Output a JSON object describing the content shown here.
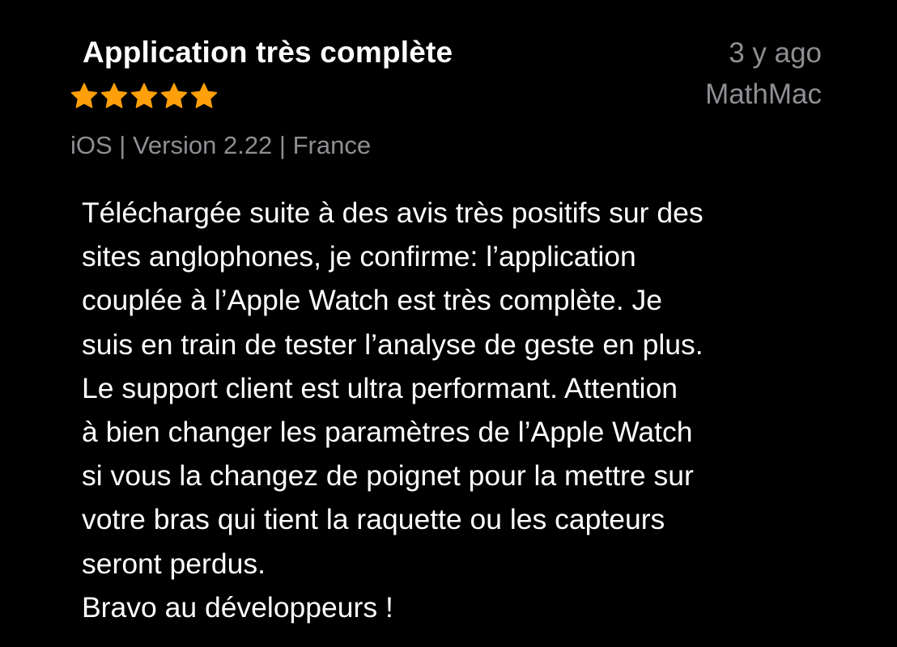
{
  "review": {
    "title": "Application très complète",
    "date": "3 y ago",
    "author": "MathMac",
    "rating": 5,
    "rating_max": 5,
    "meta": "iOS | Version 2.22 | France",
    "body_lines": [
      "Téléchargée suite à des avis très positifs sur des",
      "sites anglophones, je confirme: l’application",
      "couplée à l’Apple Watch est très complète. Je",
      "suis en train de tester l’analyse de geste en plus.",
      "Le support client est ultra performant. Attention",
      "à bien changer les paramètres de l’Apple Watch",
      "si vous la changez de poignet pour la mettre sur",
      "votre bras qui tient la raquette ou les capteurs",
      "seront perdus.",
      "Bravo au développeurs !"
    ]
  },
  "colors": {
    "background": "#000000",
    "text_primary": "#ffffff",
    "text_secondary": "#8e8e93",
    "star": "#ff9f0a"
  },
  "icons": {
    "star": "star-icon"
  }
}
